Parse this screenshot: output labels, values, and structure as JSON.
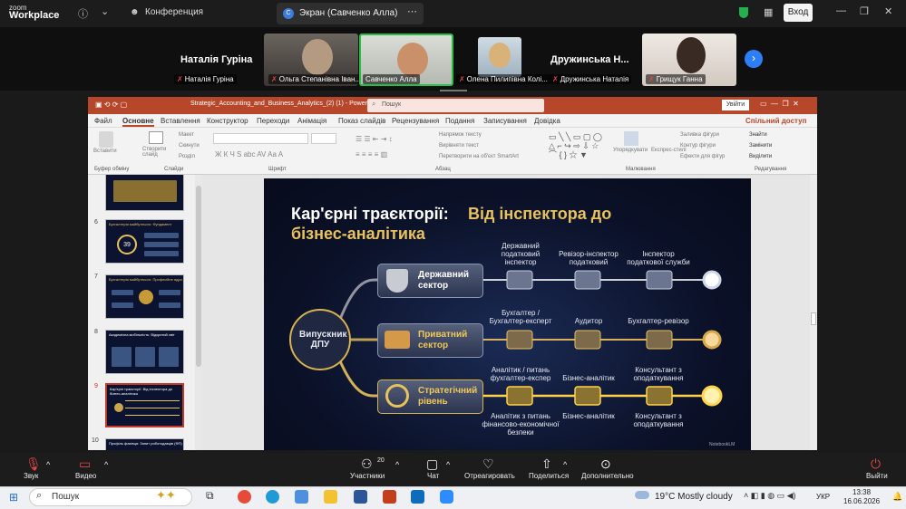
{
  "zoom": {
    "logo_line1": "zoom",
    "logo_line2": "Workplace",
    "tab_conference": "Конференция",
    "tab_screen": "Экран (Савченко Алла)",
    "login_button": "Вход"
  },
  "participants": {
    "big_left": "Наталія Гуріна",
    "big_right": "Дружинська Н...",
    "tiles": [
      {
        "name": "Наталія Гуріна"
      },
      {
        "name": "Ольга Степанівна Іван..."
      },
      {
        "name": "Савченко Алла"
      },
      {
        "name": "Олена Пилипівна Колі..."
      },
      {
        "name": "Дружинська Наталія"
      },
      {
        "name": "Грищук Ганна"
      }
    ]
  },
  "ppt": {
    "window_title": "Strategic_Accounting_and_Business_Analytics_(2) (1)  -  PowerPoint",
    "search_placeholder": "Пошук",
    "enter": "Увійти",
    "menu": [
      "Файл",
      "Основне",
      "Вставлення",
      "Конструктор",
      "Переходи",
      "Анімація",
      "Показ слайдів",
      "Рецензування",
      "Подання",
      "Записування",
      "Довідка"
    ],
    "share": "Спільний доступ",
    "ribbon_groups": [
      "Буфер обміну",
      "Слайди",
      "Шрифт",
      "Абзац",
      "Малювання",
      "Редагування"
    ],
    "ribbon_items": {
      "paste": "Вставити",
      "new_slide": "Створити слайд",
      "layout": "Макет",
      "reset": "Скинути",
      "section": "Розділ",
      "text_direction": "Напрямок тексту",
      "align_text": "Вирівняти текст",
      "smartart": "Перетворити на об'єкт SmartArt",
      "arrange": "Упорядкувати",
      "quick_styles": "Експрес-стилі",
      "shape_fill": "Заливка фігури",
      "shape_outline": "Контур фігури",
      "shape_effects": "Ефекти для фігур",
      "find": "Знайти",
      "replace": "Замінити",
      "select": "Виділити"
    },
    "thumbnails": [
      {
        "num": "",
        "title": ""
      },
      {
        "num": "6",
        "title": "Бухгалтерія майбутнього: Фундамент"
      },
      {
        "num": "7",
        "title": "Бухгалтерія майбутнього: Професійне ядро"
      },
      {
        "num": "8",
        "title": "Академічна мобільність: Відкритий світ"
      },
      {
        "num": "9",
        "title": "Кар'єрні траєкторії: Від інспектора до бізнес-аналітика"
      },
      {
        "num": "10",
        "title": "Профіль фахівця: Запит роботодавців (ФП)"
      }
    ],
    "thumb_badge": "39"
  },
  "slide": {
    "title_white": "Кар'єрні траєкторії:",
    "title_gold_1": "Від інспектора до",
    "title_gold_2": "бізнес-аналітика",
    "center": "Випускник ДПУ",
    "cards": [
      "Державний сектор",
      "Приватний сектор",
      "Стратегічний рівень"
    ],
    "row1": [
      "Державний податковий інспектор",
      "Ревізор-інспектор податковий",
      "Інспектор податкової служби"
    ],
    "row2": [
      "Бухгалтер / Бухгалтер-експерт",
      "Аудитор",
      "Бухгалтер-ревізор"
    ],
    "row3_top": [
      "Аналітик / питань фухгалтер-експер",
      "Бізнес-аналітик",
      "Консультант з оподаткування"
    ],
    "row3_bottom": [
      "Аналітик з питань фінансово-економічної безпеки",
      "Бізнес-аналітик",
      "Консультант з оподаткування"
    ],
    "credit": "NotebookLM"
  },
  "toolbar": {
    "sound": "Звук",
    "video": "Видео",
    "participants_count": "20",
    "participants": "Участники",
    "chat": "Чат",
    "react": "Отреагировать",
    "share": "Поделиться",
    "more": "Дополнительно",
    "exit": "Выйти"
  },
  "taskbar": {
    "search": "Пошук",
    "weather": "19°C  Mostly cloudy",
    "lang": "УКР",
    "time": "13:38",
    "date": "16.06.2026"
  },
  "colors": {
    "ppt_accent": "#b7472a",
    "gold": "#e8c25c",
    "slide_bg": "#0b1128",
    "zoom_bg": "#1c1c1c"
  }
}
